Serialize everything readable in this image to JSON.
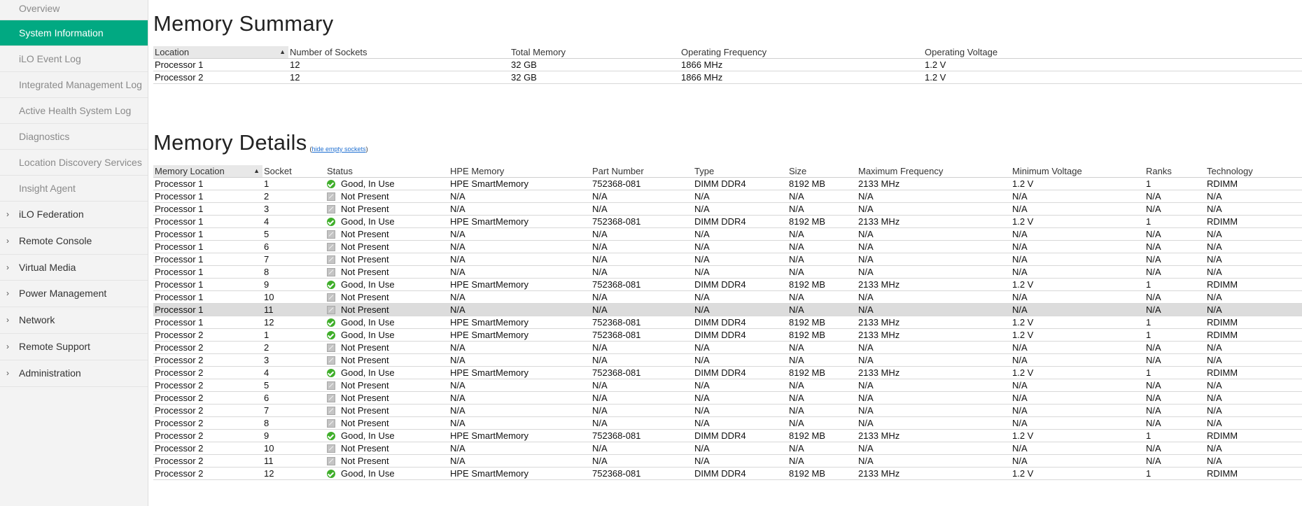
{
  "sidebar": {
    "items": [
      {
        "label": "Overview",
        "active": false
      },
      {
        "label": "System Information",
        "active": true
      },
      {
        "label": "iLO Event Log",
        "active": false
      },
      {
        "label": "Integrated Management Log",
        "active": false
      },
      {
        "label": "Active Health System Log",
        "active": false
      },
      {
        "label": "Diagnostics",
        "active": false
      },
      {
        "label": "Location Discovery Services",
        "active": false
      },
      {
        "label": "Insight Agent",
        "active": false
      }
    ],
    "groups": [
      {
        "label": "iLO Federation"
      },
      {
        "label": "Remote Console"
      },
      {
        "label": "Virtual Media"
      },
      {
        "label": "Power Management"
      },
      {
        "label": "Network"
      },
      {
        "label": "Remote Support"
      },
      {
        "label": "Administration"
      }
    ],
    "chevron_icon": "chevron-right-icon"
  },
  "summary": {
    "title": "Memory Summary",
    "columns": [
      "Location",
      "Number of Sockets",
      "Total Memory",
      "Operating Frequency",
      "Operating Voltage"
    ],
    "rows": [
      [
        "Processor 1",
        "12",
        "32 GB",
        "1866 MHz",
        "1.2 V"
      ],
      [
        "Processor 2",
        "12",
        "32 GB",
        "1866 MHz",
        "1.2 V"
      ]
    ]
  },
  "details": {
    "title": "Memory Details",
    "hide_link_open": "(",
    "hide_link_label": "hide empty sockets",
    "hide_link_close": ")",
    "columns": [
      "Memory Location",
      "Socket",
      "Status",
      "HPE Memory",
      "Part Number",
      "Type",
      "Size",
      "Maximum Frequency",
      "Minimum Voltage",
      "Ranks",
      "Technology"
    ],
    "highlighted_row": 10,
    "status_colors": {
      "ok": "#3fae2a",
      "not_present": "#c4c4c4"
    },
    "rows": [
      [
        "Processor 1",
        "1",
        "Good, In Use",
        "HPE SmartMemory",
        "752368-081",
        "DIMM DDR4",
        "8192 MB",
        "2133 MHz",
        "1.2 V",
        "1",
        "RDIMM"
      ],
      [
        "Processor 1",
        "2",
        "Not Present",
        "N/A",
        "N/A",
        "N/A",
        "N/A",
        "N/A",
        "N/A",
        "N/A",
        "N/A"
      ],
      [
        "Processor 1",
        "3",
        "Not Present",
        "N/A",
        "N/A",
        "N/A",
        "N/A",
        "N/A",
        "N/A",
        "N/A",
        "N/A"
      ],
      [
        "Processor 1",
        "4",
        "Good, In Use",
        "HPE SmartMemory",
        "752368-081",
        "DIMM DDR4",
        "8192 MB",
        "2133 MHz",
        "1.2 V",
        "1",
        "RDIMM"
      ],
      [
        "Processor 1",
        "5",
        "Not Present",
        "N/A",
        "N/A",
        "N/A",
        "N/A",
        "N/A",
        "N/A",
        "N/A",
        "N/A"
      ],
      [
        "Processor 1",
        "6",
        "Not Present",
        "N/A",
        "N/A",
        "N/A",
        "N/A",
        "N/A",
        "N/A",
        "N/A",
        "N/A"
      ],
      [
        "Processor 1",
        "7",
        "Not Present",
        "N/A",
        "N/A",
        "N/A",
        "N/A",
        "N/A",
        "N/A",
        "N/A",
        "N/A"
      ],
      [
        "Processor 1",
        "8",
        "Not Present",
        "N/A",
        "N/A",
        "N/A",
        "N/A",
        "N/A",
        "N/A",
        "N/A",
        "N/A"
      ],
      [
        "Processor 1",
        "9",
        "Good, In Use",
        "HPE SmartMemory",
        "752368-081",
        "DIMM DDR4",
        "8192 MB",
        "2133 MHz",
        "1.2 V",
        "1",
        "RDIMM"
      ],
      [
        "Processor 1",
        "10",
        "Not Present",
        "N/A",
        "N/A",
        "N/A",
        "N/A",
        "N/A",
        "N/A",
        "N/A",
        "N/A"
      ],
      [
        "Processor 1",
        "11",
        "Not Present",
        "N/A",
        "N/A",
        "N/A",
        "N/A",
        "N/A",
        "N/A",
        "N/A",
        "N/A"
      ],
      [
        "Processor 1",
        "12",
        "Good, In Use",
        "HPE SmartMemory",
        "752368-081",
        "DIMM DDR4",
        "8192 MB",
        "2133 MHz",
        "1.2 V",
        "1",
        "RDIMM"
      ],
      [
        "Processor 2",
        "1",
        "Good, In Use",
        "HPE SmartMemory",
        "752368-081",
        "DIMM DDR4",
        "8192 MB",
        "2133 MHz",
        "1.2 V",
        "1",
        "RDIMM"
      ],
      [
        "Processor 2",
        "2",
        "Not Present",
        "N/A",
        "N/A",
        "N/A",
        "N/A",
        "N/A",
        "N/A",
        "N/A",
        "N/A"
      ],
      [
        "Processor 2",
        "3",
        "Not Present",
        "N/A",
        "N/A",
        "N/A",
        "N/A",
        "N/A",
        "N/A",
        "N/A",
        "N/A"
      ],
      [
        "Processor 2",
        "4",
        "Good, In Use",
        "HPE SmartMemory",
        "752368-081",
        "DIMM DDR4",
        "8192 MB",
        "2133 MHz",
        "1.2 V",
        "1",
        "RDIMM"
      ],
      [
        "Processor 2",
        "5",
        "Not Present",
        "N/A",
        "N/A",
        "N/A",
        "N/A",
        "N/A",
        "N/A",
        "N/A",
        "N/A"
      ],
      [
        "Processor 2",
        "6",
        "Not Present",
        "N/A",
        "N/A",
        "N/A",
        "N/A",
        "N/A",
        "N/A",
        "N/A",
        "N/A"
      ],
      [
        "Processor 2",
        "7",
        "Not Present",
        "N/A",
        "N/A",
        "N/A",
        "N/A",
        "N/A",
        "N/A",
        "N/A",
        "N/A"
      ],
      [
        "Processor 2",
        "8",
        "Not Present",
        "N/A",
        "N/A",
        "N/A",
        "N/A",
        "N/A",
        "N/A",
        "N/A",
        "N/A"
      ],
      [
        "Processor 2",
        "9",
        "Good, In Use",
        "HPE SmartMemory",
        "752368-081",
        "DIMM DDR4",
        "8192 MB",
        "2133 MHz",
        "1.2 V",
        "1",
        "RDIMM"
      ],
      [
        "Processor 2",
        "10",
        "Not Present",
        "N/A",
        "N/A",
        "N/A",
        "N/A",
        "N/A",
        "N/A",
        "N/A",
        "N/A"
      ],
      [
        "Processor 2",
        "11",
        "Not Present",
        "N/A",
        "N/A",
        "N/A",
        "N/A",
        "N/A",
        "N/A",
        "N/A",
        "N/A"
      ],
      [
        "Processor 2",
        "12",
        "Good, In Use",
        "HPE SmartMemory",
        "752368-081",
        "DIMM DDR4",
        "8192 MB",
        "2133 MHz",
        "1.2 V",
        "1",
        "RDIMM"
      ]
    ]
  }
}
